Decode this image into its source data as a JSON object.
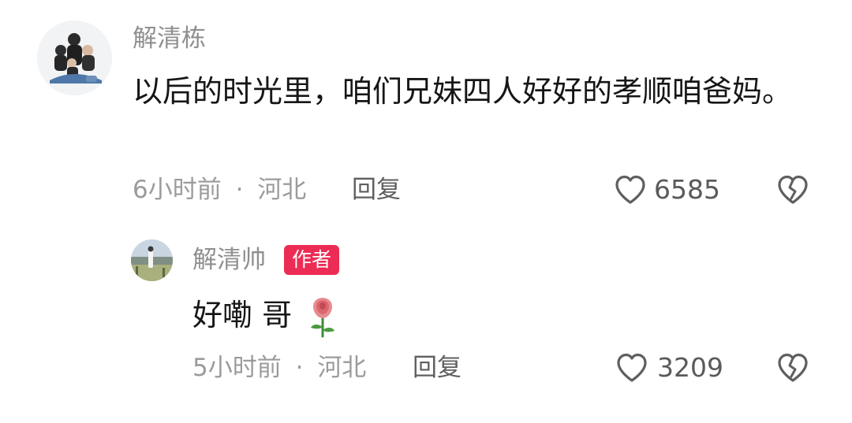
{
  "colors": {
    "author_badge": "#ec2c55",
    "username": "#8f8f8f",
    "text": "#161616",
    "meta": "#9b9b9b",
    "icon": "#5f5f5f"
  },
  "comment": {
    "username": "解清栋",
    "text": "以后的时光里，咱们兄妹四人好好的孝顺咱爸妈。",
    "time": "6小时前",
    "separator": "·",
    "location": "河北",
    "reply_label": "回复",
    "like_count": "6585",
    "like_icon": "heart-outline-icon",
    "dislike_icon": "broken-heart-icon"
  },
  "reply": {
    "username": "解清帅",
    "badge": "作者",
    "text": "好嘞 哥",
    "emoji": "rose-emoji",
    "time": "5小时前",
    "separator": "·",
    "location": "河北",
    "reply_label": "回复",
    "like_count": "3209",
    "like_icon": "heart-outline-icon",
    "dislike_icon": "broken-heart-icon"
  }
}
